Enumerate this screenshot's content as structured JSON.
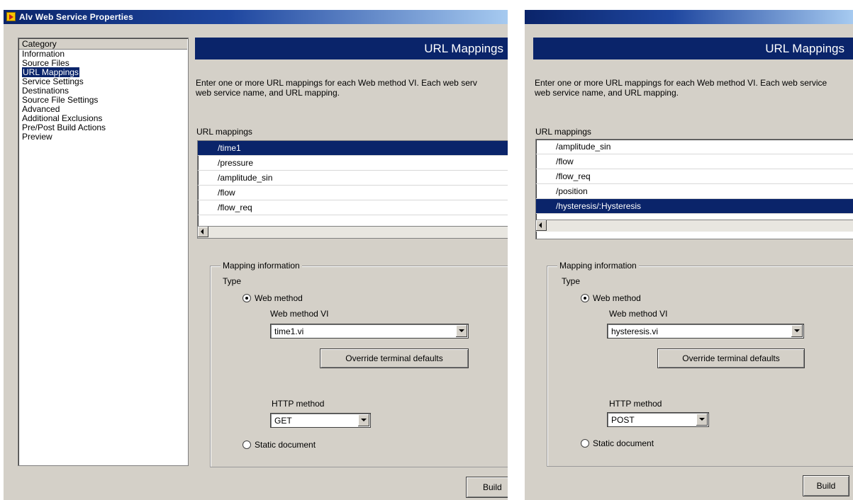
{
  "window1": {
    "title": "Alv Web Service Properties",
    "category_header": "Category",
    "categories": [
      "Information",
      "Source Files",
      "URL Mappings",
      "Service Settings",
      "Destinations",
      "Source File Settings",
      "Advanced",
      "Additional Exclusions",
      "Pre/Post Build Actions",
      "Preview"
    ],
    "selected_category": "URL Mappings",
    "section_title": "URL Mappings",
    "description_line1": "Enter one or more URL mappings for each Web method VI. Each web serv",
    "description_line2": "web service name, and URL mapping.",
    "url_mappings_label": "URL mappings",
    "url_mappings": [
      "/time1",
      "/pressure",
      "/amplitude_sin",
      "/flow",
      "/flow_req"
    ],
    "selected_url": "/time1",
    "mapping_information_label": "Mapping information",
    "type_label": "Type",
    "web_method_label": "Web method",
    "web_method_vi_label": "Web method VI",
    "web_method_vi_value": "time1.vi",
    "override_button": "Override terminal defaults",
    "http_method_label": "HTTP method",
    "http_method_value": "GET",
    "static_document_label": "Static document",
    "build_button": "Build"
  },
  "window2": {
    "section_title": "URL Mappings",
    "description_line1": "Enter one or more URL mappings for each Web method VI. Each web service",
    "description_line2": "web service name, and URL mapping.",
    "url_mappings_label": "URL mappings",
    "url_mappings": [
      "/amplitude_sin",
      "/flow",
      "/flow_req",
      "/position",
      "/hysteresis/:Hysteresis"
    ],
    "selected_url": "/hysteresis/:Hysteresis",
    "mapping_information_label": "Mapping information",
    "type_label": "Type",
    "web_method_label": "Web method",
    "web_method_vi_label": "Web method VI",
    "web_method_vi_value": "hysteresis.vi",
    "override_button": "Override terminal defaults",
    "http_method_label": "HTTP method",
    "http_method_value": "POST",
    "static_document_label": "Static document",
    "build_button": "Build"
  },
  "colors": {
    "title_bar": "#0a246a",
    "section_header": "#0a246a",
    "selection": "#0a246a",
    "dialog_background": "#d4d0c8"
  }
}
